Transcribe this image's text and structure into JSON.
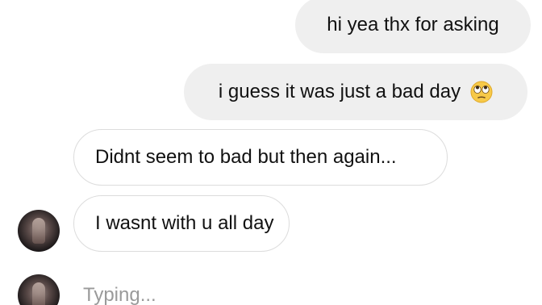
{
  "thread": {
    "messages": [
      {
        "direction": "outgoing",
        "text": "hi yea thx for asking"
      },
      {
        "direction": "outgoing",
        "text": "i guess it was just a bad day",
        "emoji": "eye-roll-emoji"
      },
      {
        "direction": "incoming",
        "text": "Didnt seem to bad but then again..."
      },
      {
        "direction": "incoming",
        "text": "I wasnt with u all day"
      }
    ],
    "typing_indicator": "Typing..."
  },
  "colors": {
    "outgoing_bubble": "#efefef",
    "incoming_bubble_border": "#dcdcdc",
    "message_text": "#111111",
    "typing_text": "#9a9a9a",
    "emoji_face": "#f7c948"
  }
}
